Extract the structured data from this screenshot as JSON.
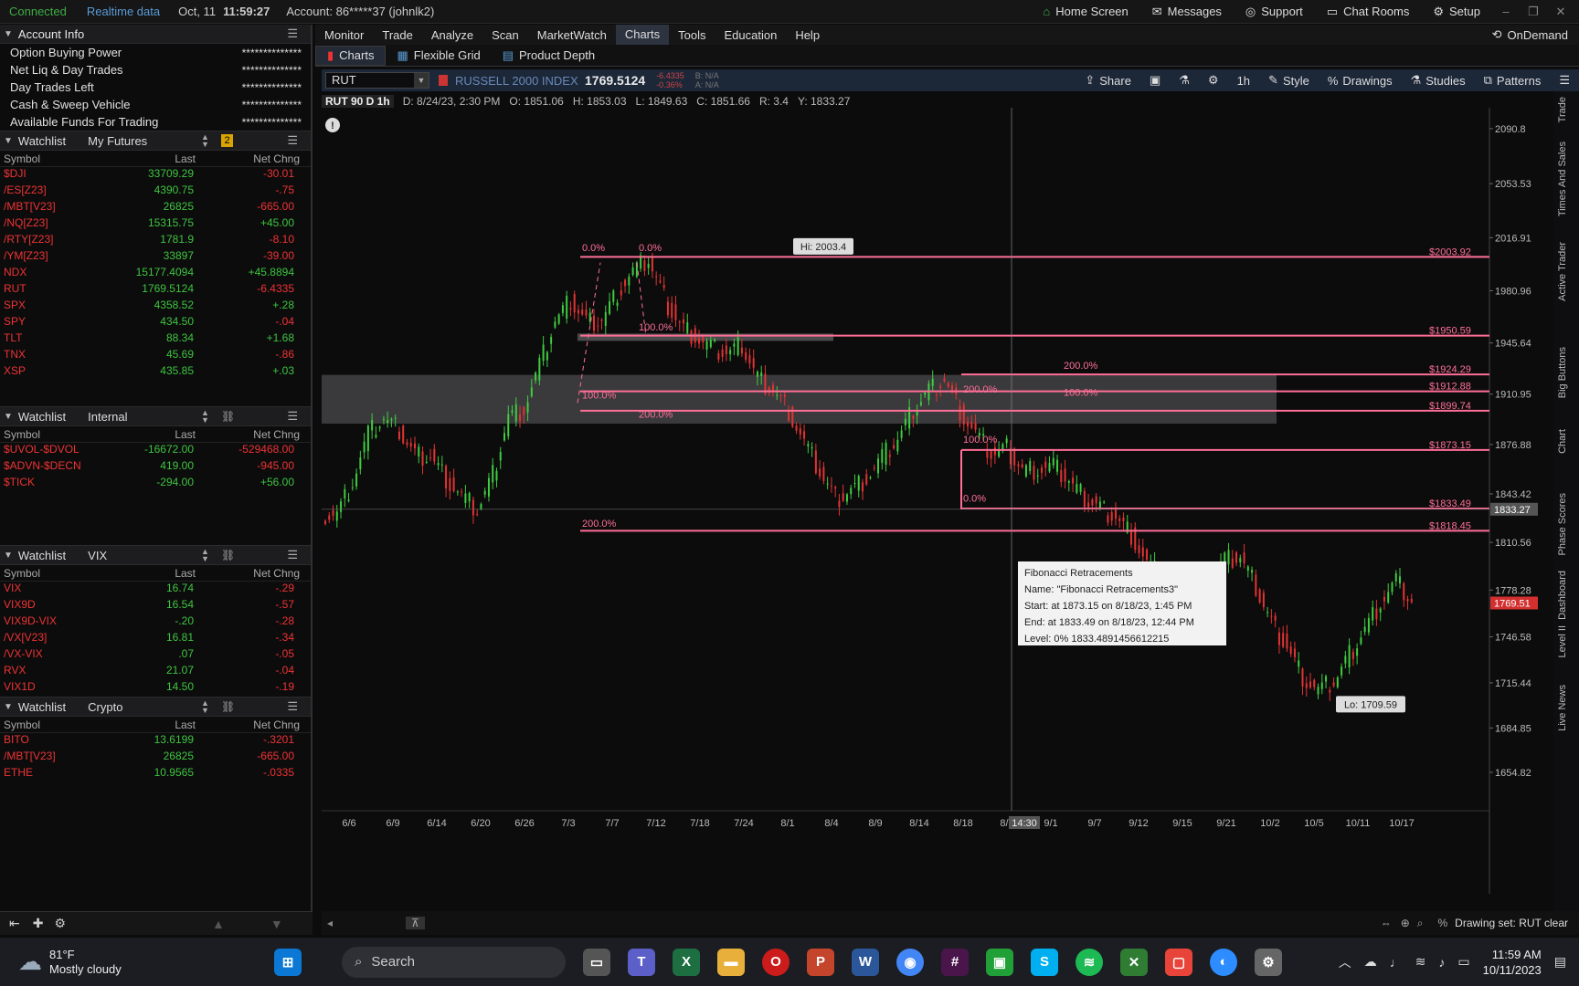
{
  "topbar": {
    "status": "Connected",
    "realtime": "Realtime data",
    "date": "Oct, 11",
    "time": "11:59:27",
    "account": "Account: 86*****37 (johnlk2)",
    "home": "Home Screen",
    "messages": "Messages",
    "support": "Support",
    "chat": "Chat Rooms",
    "setup": "Setup"
  },
  "account_info": {
    "title": "Account Info",
    "rows": [
      {
        "label": "Option Buying Power",
        "value": "**************"
      },
      {
        "label": "Net Liq & Day Trades",
        "value": "**************"
      },
      {
        "label": "Day Trades Left",
        "value": "**************"
      },
      {
        "label": "Cash & Sweep Vehicle",
        "value": "**************"
      },
      {
        "label": "Available Funds For Trading",
        "value": "**************"
      }
    ]
  },
  "watchlists": [
    {
      "title": "Watchlist",
      "name": "My Futures",
      "badge": "2",
      "cols": [
        "Symbol",
        "Last",
        "Net Chng"
      ],
      "rows": [
        {
          "sym": "$DJI",
          "last": "33709.29",
          "chg": "-30.01",
          "dir": "neg"
        },
        {
          "sym": "/ES[Z23]",
          "last": "4390.75",
          "chg": "-.75",
          "dir": "neg"
        },
        {
          "sym": "/MBT[V23]",
          "last": "26825",
          "chg": "-665.00",
          "dir": "neg"
        },
        {
          "sym": "/NQ[Z23]",
          "last": "15315.75",
          "chg": "+45.00",
          "dir": "pos"
        },
        {
          "sym": "/RTY[Z23]",
          "last": "1781.9",
          "chg": "-8.10",
          "dir": "neg"
        },
        {
          "sym": "/YM[Z23]",
          "last": "33897",
          "chg": "-39.00",
          "dir": "neg"
        },
        {
          "sym": "NDX",
          "last": "15177.4094",
          "chg": "+45.8894",
          "dir": "pos"
        },
        {
          "sym": "RUT",
          "last": "1769.5124",
          "chg": "-6.4335",
          "dir": "neg"
        },
        {
          "sym": "SPX",
          "last": "4358.52",
          "chg": "+.28",
          "dir": "pos"
        },
        {
          "sym": "SPY",
          "last": "434.50",
          "chg": "-.04",
          "dir": "neg"
        },
        {
          "sym": "TLT",
          "last": "88.34",
          "chg": "+1.68",
          "dir": "pos"
        },
        {
          "sym": "TNX",
          "last": "45.69",
          "chg": "-.86",
          "dir": "neg"
        },
        {
          "sym": "XSP",
          "last": "435.85",
          "chg": "+.03",
          "dir": "pos"
        }
      ]
    },
    {
      "title": "Watchlist",
      "name": "Internal",
      "cols": [
        "Symbol",
        "Last",
        "Net Chng"
      ],
      "rows": [
        {
          "sym": "$UVOL-$DVOL",
          "last": "-16672.00",
          "chg": "-529468.00",
          "dir": "neg"
        },
        {
          "sym": "$ADVN-$DECN",
          "last": "419.00",
          "chg": "-945.00",
          "dir": "neg"
        },
        {
          "sym": "$TICK",
          "last": "-294.00",
          "chg": "+56.00",
          "dir": "pos"
        }
      ]
    },
    {
      "title": "Watchlist",
      "name": "VIX",
      "cols": [
        "Symbol",
        "Last",
        "Net Chng"
      ],
      "rows": [
        {
          "sym": "VIX",
          "last": "16.74",
          "chg": "-.29",
          "dir": "neg"
        },
        {
          "sym": "VIX9D",
          "last": "16.54",
          "chg": "-.57",
          "dir": "neg"
        },
        {
          "sym": "VIX9D-VIX",
          "last": "-.20",
          "chg": "-.28",
          "dir": "neg"
        },
        {
          "sym": "/VX[V23]",
          "last": "16.81",
          "chg": "-.34",
          "dir": "neg"
        },
        {
          "sym": "/VX-VIX",
          "last": ".07",
          "chg": "-.05",
          "dir": "neg"
        },
        {
          "sym": "RVX",
          "last": "21.07",
          "chg": "-.04",
          "dir": "neg"
        },
        {
          "sym": "VIX1D",
          "last": "14.50",
          "chg": "-.19",
          "dir": "neg"
        }
      ]
    },
    {
      "title": "Watchlist",
      "name": "Crypto",
      "cols": [
        "Symbol",
        "Last",
        "Net Chng"
      ],
      "rows": [
        {
          "sym": "BITO",
          "last": "13.6199",
          "chg": "-.3201",
          "dir": "neg"
        },
        {
          "sym": "/MBT[V23]",
          "last": "26825",
          "chg": "-665.00",
          "dir": "neg"
        },
        {
          "sym": "ETHE",
          "last": "10.9565",
          "chg": "-.0335",
          "dir": "neg"
        }
      ]
    }
  ],
  "menu": [
    "Monitor",
    "Trade",
    "Analyze",
    "Scan",
    "MarketWatch",
    "Charts",
    "Tools",
    "Education",
    "Help"
  ],
  "ondemand": "OnDemand",
  "tabs": [
    "Charts",
    "Flexible Grid",
    "Product Depth"
  ],
  "symbol": {
    "sym": "RUT",
    "desc": "RUSSELL 2000 INDEX",
    "price": "1769.5124",
    "chg1": "-6.4335",
    "chg2": "-0.36%",
    "bid": "B: N/A",
    "ask": "A: N/A"
  },
  "chart_tools": [
    "Share",
    "1h",
    "Style",
    "Drawings",
    "Studies",
    "Patterns"
  ],
  "infobar": {
    "tf": "RUT 90 D 1h",
    "d": "D: 8/24/23, 2:30 PM",
    "o": "O: 1851.06",
    "h": "H: 1853.03",
    "l": "L: 1849.63",
    "c": "C: 1851.66",
    "r": "R: 3.4",
    "y": "Y: 1833.27"
  },
  "chart_data": {
    "type": "candlestick",
    "ylim": [
      1635,
      2100
    ],
    "yticks": [
      2090.8,
      2053.53,
      2016.91,
      1980.96,
      1945.64,
      1910.95,
      1876.88,
      1843.42,
      1810.56,
      1778.28,
      1746.58,
      1715.44,
      1684.85,
      1654.82
    ],
    "xticks": [
      "6/6",
      "6/9",
      "6/14",
      "6/20",
      "6/26",
      "7/3",
      "7/7",
      "7/12",
      "7/18",
      "7/24",
      "8/1",
      "8/4",
      "8/9",
      "8/14",
      "8/18",
      "8/2",
      "9/1",
      "9/7",
      "9/12",
      "9/15",
      "9/21",
      "10/2",
      "10/5",
      "10/11",
      "10/17"
    ],
    "cursor_time": "14:30",
    "series": [
      {
        "name": "RUT",
        "close": [
          1830,
          1852,
          1884,
          1894,
          1886,
          1870,
          1869,
          1854,
          1842,
          1832,
          1856,
          1896,
          1901,
          1930,
          1960,
          1974,
          1960,
          1962,
          1980,
          1994,
          2002,
          1976,
          1958,
          1950,
          1942,
          1938,
          1944,
          1922,
          1914,
          1900,
          1878,
          1858,
          1840,
          1846,
          1854,
          1868,
          1880,
          1900,
          1914,
          1921,
          1900,
          1884,
          1870,
          1874,
          1860,
          1860,
          1862,
          1852,
          1840,
          1834,
          1828,
          1816,
          1796,
          1786,
          1781,
          1776,
          1784,
          1798,
          1800,
          1780,
          1756,
          1740,
          1720,
          1710,
          1716,
          1734,
          1752,
          1770,
          1784,
          1770
        ]
      }
    ],
    "price_labels": [
      "$2003.92",
      "$1950.59",
      "$1924.29",
      "$1912.88",
      "$1899.74",
      "$1873.15",
      "$1833.49",
      "$1818.45"
    ],
    "current_price": "1769.51",
    "cursor_price": "1833.27",
    "fib_pct_labels": [
      "0.0%",
      "0.0%",
      "100.0%",
      "100.0%",
      "200.0%",
      "200.0%",
      "200.0%",
      "100.0%",
      "100.0%",
      "0.0%",
      "200.0%"
    ],
    "hi": "Hi: 2003.4",
    "lo": "Lo: 1709.59",
    "tooltip": [
      "Fibonacci Retracements",
      "Name: \"Fibonacci Retracements3\"",
      "Start: at 1873.15 on 8/18/23, 1:45 PM",
      "End: at 1833.49 on 8/18/23, 12:44 PM",
      "Level: 0% 1833.4891456612215"
    ]
  },
  "right_tabs": [
    "Trade",
    "Times And Sales",
    "Active Trader",
    "Big Buttons",
    "Chart",
    "Phase Scores",
    "Dashboard",
    "Level II",
    "Live News"
  ],
  "footer": {
    "drawing_set": "Drawing set: RUT clear"
  },
  "taskbar": {
    "temp": "81°F",
    "weather": "Mostly cloudy",
    "search": "Search",
    "time": "11:59 AM",
    "date": "10/11/2023"
  },
  "colors": {
    "accent": "#3fc43f",
    "negative": "#e33333",
    "fib": "#ff6f97",
    "brand": "#1c2738"
  }
}
